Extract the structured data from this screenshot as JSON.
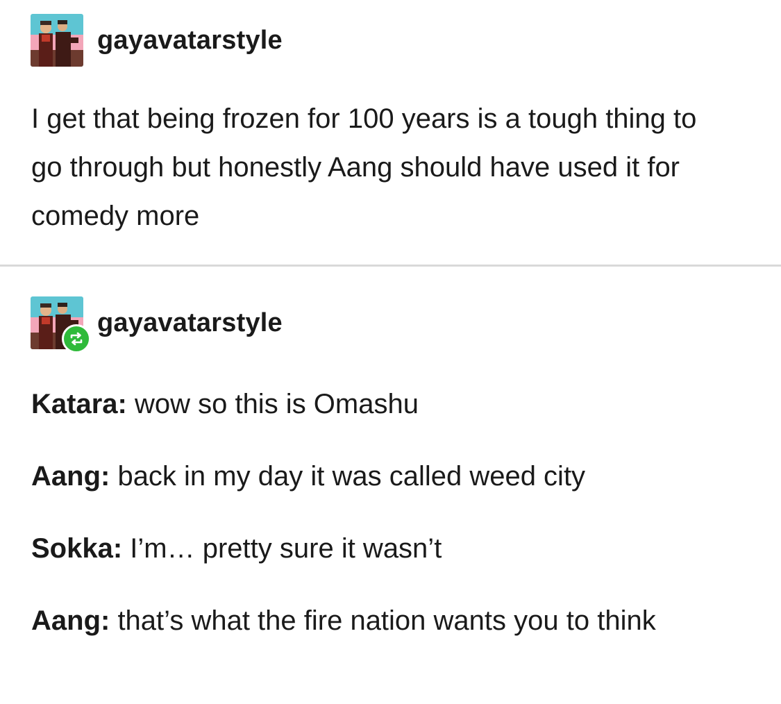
{
  "posts": [
    {
      "username": "gayavatarstyle",
      "avatar_icon": "avatar-image",
      "body": "I get that being frozen for 100 years is a tough thing to go through but honestly Aang should have used it for comedy more"
    },
    {
      "username": "gayavatarstyle",
      "avatar_icon": "avatar-image",
      "badge_icon": "reblog-icon",
      "badge_color": "#2fba3a",
      "lines": [
        {
          "speaker": "Katara",
          "sep": ":",
          "text": " wow so this is Omashu"
        },
        {
          "speaker": "Aang",
          "sep": ":",
          "text": " back in my day it was called weed city"
        },
        {
          "speaker": "Sokka",
          "sep": ":",
          "text": " I’m… pretty sure it wasn’t"
        },
        {
          "speaker": "Aang",
          "sep": ":",
          "text": " that’s what the fire nation wants you to think"
        }
      ]
    }
  ]
}
